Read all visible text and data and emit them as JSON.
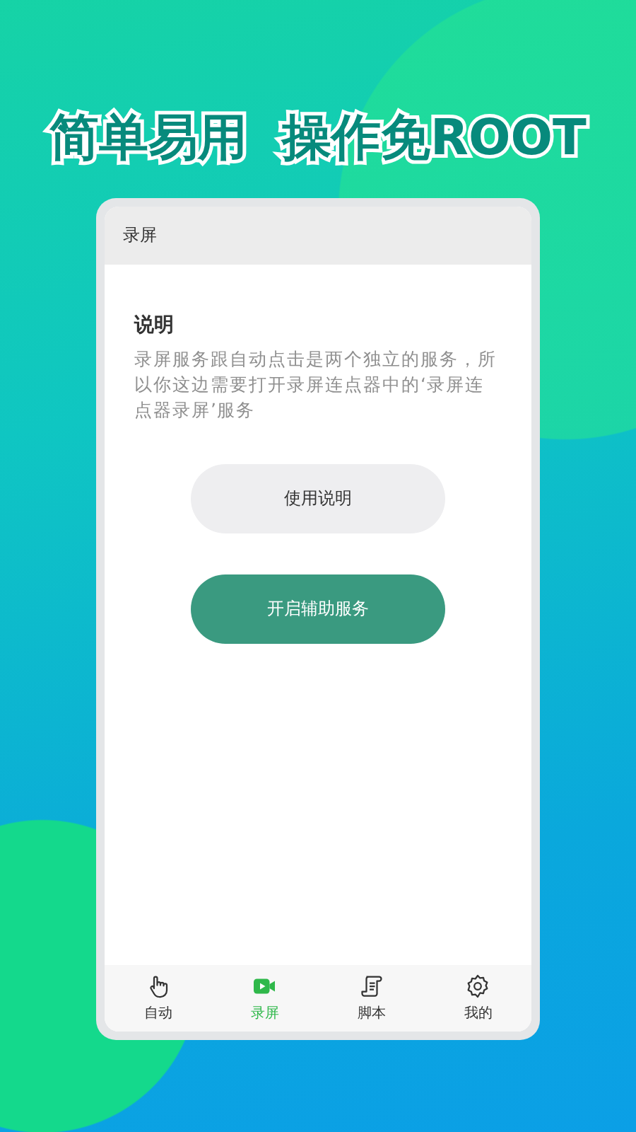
{
  "headline": "简单易用  操作免ROOT",
  "app_bar": {
    "title": "录屏"
  },
  "section": {
    "title": "说明",
    "text": "录屏服务跟自动点击是两个独立的服务，所以你这边需要打开录屏连点器中的‘录屏连点器录屏’服务"
  },
  "buttons": [
    {
      "label": "使用说明",
      "kind": "secondary"
    },
    {
      "label": "开启辅助服务",
      "kind": "primary"
    }
  ],
  "tabs": [
    {
      "label": "自动",
      "selected": false
    },
    {
      "label": "录屏",
      "selected": true
    },
    {
      "label": "脚本",
      "selected": false
    },
    {
      "label": "我的",
      "selected": false
    }
  ]
}
